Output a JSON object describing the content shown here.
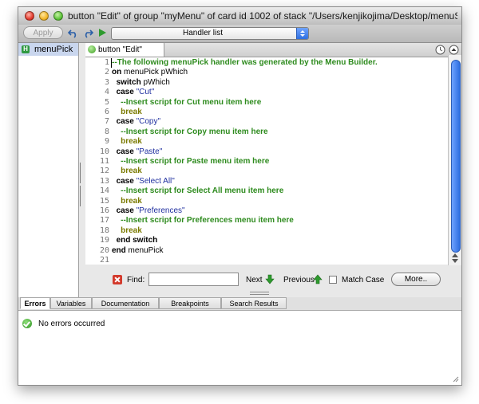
{
  "window": {
    "title": "button \"Edit\" of group \"myMenu\" of card id 1002 of stack \"/Users/kenjikojima/Desktop/menuStud..."
  },
  "toolbar": {
    "apply_label": "Apply",
    "handler_select": "Handler list"
  },
  "handlers": [
    {
      "badge": "H",
      "name": "menuPick"
    }
  ],
  "editor": {
    "tab_label": "button \"Edit\"",
    "lines": [
      {
        "n": "1",
        "indent": "",
        "parts": [
          {
            "t": "--The following menuPick handler was generated by the Menu Builder.",
            "c": "cm"
          }
        ]
      },
      {
        "n": "2",
        "indent": "",
        "parts": [
          {
            "t": "on",
            "c": "kw"
          },
          {
            "t": " menuPick pWhich",
            "c": "plain"
          }
        ]
      },
      {
        "n": "3",
        "indent": "  ",
        "parts": [
          {
            "t": "switch",
            "c": "kw"
          },
          {
            "t": " pWhich",
            "c": "plain"
          }
        ]
      },
      {
        "n": "4",
        "indent": "  ",
        "parts": [
          {
            "t": "case",
            "c": "kw"
          },
          {
            "t": " ",
            "c": "plain"
          },
          {
            "t": "\"Cut\"",
            "c": "str"
          }
        ]
      },
      {
        "n": "5",
        "indent": "    ",
        "parts": [
          {
            "t": "--Insert script for Cut menu item here",
            "c": "cm"
          }
        ]
      },
      {
        "n": "6",
        "indent": "    ",
        "parts": [
          {
            "t": "break",
            "c": "brk"
          }
        ]
      },
      {
        "n": "7",
        "indent": "  ",
        "parts": [
          {
            "t": "case",
            "c": "kw"
          },
          {
            "t": " ",
            "c": "plain"
          },
          {
            "t": "\"Copy\"",
            "c": "str"
          }
        ]
      },
      {
        "n": "8",
        "indent": "    ",
        "parts": [
          {
            "t": "--Insert script for Copy menu item here",
            "c": "cm"
          }
        ]
      },
      {
        "n": "9",
        "indent": "    ",
        "parts": [
          {
            "t": "break",
            "c": "brk"
          }
        ]
      },
      {
        "n": "10",
        "indent": "  ",
        "parts": [
          {
            "t": "case",
            "c": "kw"
          },
          {
            "t": " ",
            "c": "plain"
          },
          {
            "t": "\"Paste\"",
            "c": "str"
          }
        ]
      },
      {
        "n": "11",
        "indent": "    ",
        "parts": [
          {
            "t": "--Insert script for Paste menu item here",
            "c": "cm"
          }
        ]
      },
      {
        "n": "12",
        "indent": "    ",
        "parts": [
          {
            "t": "break",
            "c": "brk"
          }
        ]
      },
      {
        "n": "13",
        "indent": "  ",
        "parts": [
          {
            "t": "case",
            "c": "kw"
          },
          {
            "t": " ",
            "c": "plain"
          },
          {
            "t": "\"Select All\"",
            "c": "str"
          }
        ]
      },
      {
        "n": "14",
        "indent": "    ",
        "parts": [
          {
            "t": "--Insert script for Select All menu item here",
            "c": "cm"
          }
        ]
      },
      {
        "n": "15",
        "indent": "    ",
        "parts": [
          {
            "t": "break",
            "c": "brk"
          }
        ]
      },
      {
        "n": "16",
        "indent": "  ",
        "parts": [
          {
            "t": "case",
            "c": "kw"
          },
          {
            "t": " ",
            "c": "plain"
          },
          {
            "t": "\"Preferences\"",
            "c": "str"
          }
        ]
      },
      {
        "n": "17",
        "indent": "    ",
        "parts": [
          {
            "t": "--Insert script for Preferences menu item here",
            "c": "cm"
          }
        ]
      },
      {
        "n": "18",
        "indent": "    ",
        "parts": [
          {
            "t": "break",
            "c": "brk"
          }
        ]
      },
      {
        "n": "19",
        "indent": "  ",
        "parts": [
          {
            "t": "end switch",
            "c": "kw"
          }
        ]
      },
      {
        "n": "20",
        "indent": "",
        "parts": [
          {
            "t": "end",
            "c": "kw"
          },
          {
            "t": " menuPick",
            "c": "plain"
          }
        ]
      },
      {
        "n": "21",
        "indent": "",
        "parts": []
      }
    ]
  },
  "find": {
    "label": "Find:",
    "value": "",
    "next_label": "Next",
    "previous_label": "Previous",
    "match_case_label": "Match Case",
    "match_case_checked": false,
    "more_label": "More.."
  },
  "bottom_tabs": [
    "Errors",
    "Variables",
    "Documentation",
    "Breakpoints",
    "Search Results"
  ],
  "bottom_tab_active": "Errors",
  "errors": {
    "message": "No errors occurred"
  },
  "colors": {
    "comment": "#2e8b1e",
    "string": "#1f2f9f",
    "break": "#7a7a00",
    "selection": "#c9d6ee"
  }
}
